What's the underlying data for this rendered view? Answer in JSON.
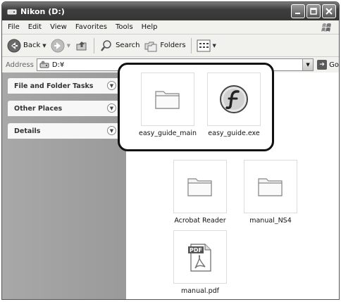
{
  "window": {
    "title": "Nikon (D:)"
  },
  "menu": [
    "File",
    "Edit",
    "View",
    "Favorites",
    "Tools",
    "Help"
  ],
  "toolbar": {
    "back_label": "Back",
    "search_label": "Search",
    "folders_label": "Folders"
  },
  "address": {
    "label": "Address",
    "path": "D:¥",
    "go_label": "Go"
  },
  "tasks": [
    {
      "label": "File and Folder Tasks"
    },
    {
      "label": "Other Places"
    },
    {
      "label": "Details"
    }
  ],
  "files": [
    {
      "name": "easy_guide_main",
      "icon": "folder-icon"
    },
    {
      "name": "easy_guide.exe",
      "icon": "flash-icon"
    },
    {
      "name": "Acrobat Reader",
      "icon": "folder-icon"
    },
    {
      "name": "manual_NS4",
      "icon": "folder-icon"
    },
    {
      "name": "manual.pdf",
      "icon": "pdf-icon",
      "badge": "PDF"
    }
  ],
  "colors": {
    "titlebar": "#3e3e3e",
    "leftpane": "#a0a0a0",
    "highlight": "#111111"
  }
}
